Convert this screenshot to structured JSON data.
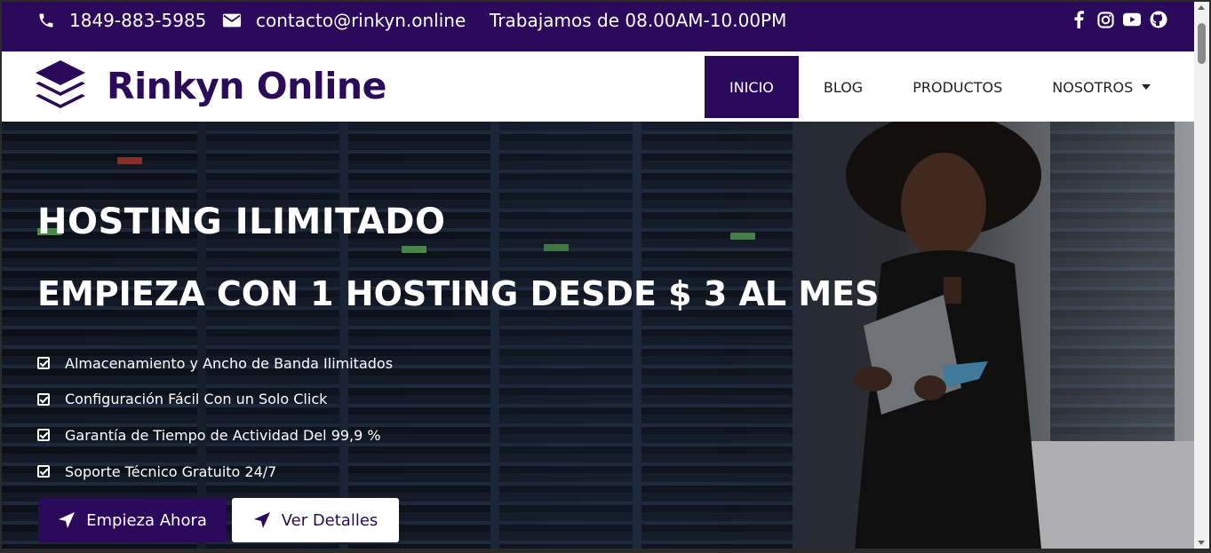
{
  "topbar": {
    "phone": "1849-883-5985",
    "email": "contacto@rinkyn.online",
    "hours": "Trabajamos de 08.00AM-10.00PM",
    "socials": [
      "facebook-icon",
      "instagram-icon",
      "youtube-icon",
      "github-icon"
    ]
  },
  "header": {
    "brand": "Rinkyn Online",
    "nav": [
      {
        "label": "INICIO",
        "active": true
      },
      {
        "label": "BLOG"
      },
      {
        "label": "PRODUCTOS"
      },
      {
        "label": "NOSOTROS",
        "dropdown": true
      }
    ]
  },
  "hero": {
    "title": "HOSTING ILIMITADO",
    "subtitle": "EMPIEZA CON 1 HOSTING DESDE $ 3 AL MES",
    "features": [
      "Almacenamiento y Ancho de Banda Ilimitados",
      "Configuración Fácil Con un Solo Click",
      "Garantía de Tiempo de Actividad Del 99,9 %",
      "Soporte Técnico Gratuito 24/7"
    ],
    "primary_button": "Empieza Ahora",
    "secondary_button": "Ver Detalles"
  },
  "colors": {
    "brand": "#2b0a5c",
    "white": "#ffffff"
  }
}
